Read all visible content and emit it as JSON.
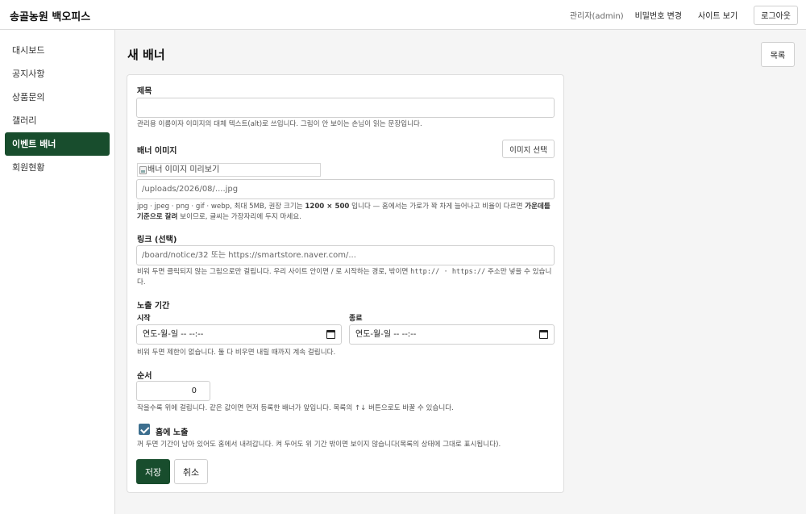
{
  "app": {
    "brand": "송골농원 백오피스",
    "admin_label": "관리자(admin)",
    "change_password": "비밀번호 변경",
    "view_site": "사이트 보기",
    "logout": "로그아웃"
  },
  "sidebar": {
    "items": [
      {
        "label": "대시보드",
        "active": false
      },
      {
        "label": "공지사항",
        "active": false
      },
      {
        "label": "상품문의",
        "active": false
      },
      {
        "label": "갤러리",
        "active": false
      },
      {
        "label": "이벤트 배너",
        "active": true
      },
      {
        "label": "회원현황",
        "active": false
      }
    ]
  },
  "page": {
    "title": "새 배너",
    "list_button": "목록"
  },
  "form": {
    "title": {
      "label": "제목",
      "value": "",
      "hint": "관리용 이름이자 이미지의 대체 텍스트(alt)로 쓰입니다. 그림이 안 보이는 손님이 읽는 문장입니다."
    },
    "image": {
      "label": "배너 이미지",
      "select_button": "이미지 선택",
      "preview_alt": "배너 이미지 미리보기",
      "path_placeholder": "/uploads/2026/08/....jpg",
      "hint_part1": "jpg · jpeg · png · gif · webp, 최대 5MB, 권장 크기는 ",
      "hint_size": "1200 × 500",
      "hint_part2": " 입니다 — 홈에서는 가로가 꽉 차게 늘어나고 비율이 다르면 ",
      "hint_bold": "가운데를 기준으로 잘려",
      "hint_part3": " 보이므로, 글씨는 가장자리에 두지 마세요."
    },
    "link": {
      "label": "링크 (선택)",
      "placeholder": "/board/notice/32 또는 https://smartstore.naver.com/...",
      "hint_part1": "비워 두면 클릭되지 않는 그림으로만 걸립니다. 우리 사이트 안이면 / 로 시작하는 경로, 밖이면 ",
      "hint_code": "http:// · https://",
      "hint_part2": " 주소만 넣을 수 있습니다."
    },
    "period": {
      "label": "노출 기간",
      "start_label": "시작",
      "end_label": "종료",
      "start_value": "연도-월-일 -- --:--",
      "end_value": "연도-월-일 -- --:--",
      "hint": "비워 두면 제한이 없습니다. 둘 다 비우면 내릴 때까지 계속 걸립니다."
    },
    "order": {
      "label": "순서",
      "value": "0",
      "hint": "작을수록 위에 걸립니다. 같은 값이면 먼저 등록한 배너가 앞입니다. 목록의 ↑↓ 버튼으로도 바꿀 수 있습니다."
    },
    "home": {
      "label": "홈에 노출",
      "checked": true,
      "hint": "꺼 두면 기간이 남아 있어도 홈에서 내려갑니다. 켜 두어도 위 기간 밖이면 보이지 않습니다(목록의 상태에 그대로 표시됩니다)."
    },
    "save_button": "저장",
    "cancel_button": "취소"
  },
  "colors": {
    "accent": "#184d2d",
    "checkbox": "#3d6f8f"
  }
}
